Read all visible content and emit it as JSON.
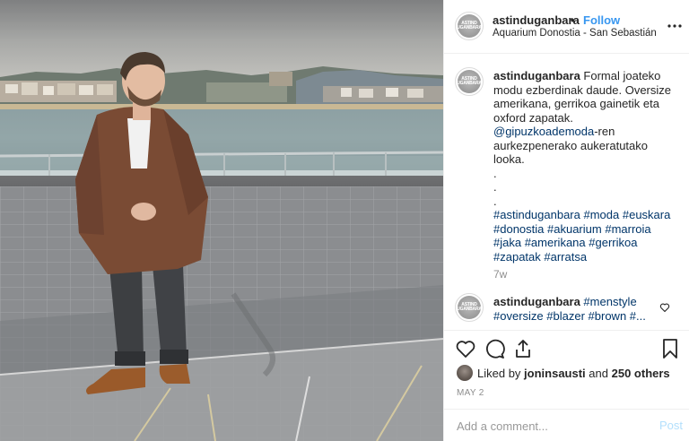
{
  "header": {
    "username": "astinduganbara",
    "separator": "•",
    "follow_label": "Follow",
    "location": "Aquarium Donostia - San Sebastián"
  },
  "avatar_logo": "ASTIND\nUGANBARA",
  "caption": {
    "username": "astinduganbara",
    "text": "Formal joateko modu ezberdinak daude. Oversize amerikana, gerrikoa gainetik eta oxford zapatak.",
    "mention": "@gipuzkoademoda",
    "text2": "-ren aurkezpenerako aukeratutako looka.",
    "dots": [
      ".",
      ".",
      "."
    ],
    "hashtags": [
      "#astinduganbara",
      "#moda",
      "#euskara",
      "#donostia",
      "#akuarium",
      "#marroia",
      "#jaka",
      "#amerikana",
      "#gerrikoa",
      "#zapatak",
      "#arratsa"
    ]
  },
  "time_ago": "7w",
  "comment2": {
    "username": "astinduganbara",
    "hashtags": [
      "#menstyle",
      "#oversize",
      "#blazer",
      "#brown",
      "#..."
    ]
  },
  "likes": {
    "user": "joninsausti",
    "text_and": "and",
    "count_text": "250 others",
    "prefix": "Liked by"
  },
  "date": "MAY 2",
  "add_comment": {
    "placeholder": "Add a comment...",
    "post_label": "Post"
  },
  "icons": [
    "more-icon",
    "heart-icon",
    "comment-icon",
    "share-icon",
    "bookmark-icon"
  ],
  "colors": {
    "link": "#003569",
    "follow": "#3897f0",
    "muted": "#8e8e8e",
    "post_disabled": "#b2dffc"
  }
}
